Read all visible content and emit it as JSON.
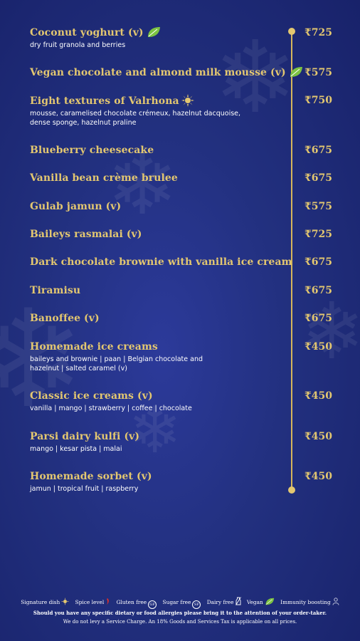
{
  "colors": {
    "background": "#22307f",
    "gold": "#e3c770",
    "leaf": "#7cc242"
  },
  "items": [
    {
      "name": "Coconut yoghurt (v)",
      "desc": "dry fruit granola and berries",
      "price": "₹725",
      "icon": "leaf-icon"
    },
    {
      "name": "Vegan chocolate and almond milk mousse (v)",
      "desc": "",
      "price": "₹575",
      "icon": "leaf-icon"
    },
    {
      "name": "Eight textures of Valrhona",
      "desc": "mousse, caramelised chocolate crémeux, hazelnut dacquoise,",
      "desc2": "dense sponge, hazelnut praline",
      "price": "₹750",
      "icon": "signature-icon"
    },
    {
      "name": "Blueberry cheesecake",
      "desc": "",
      "price": "₹675"
    },
    {
      "name": "Vanilla bean crème brulee",
      "desc": "",
      "price": "₹675"
    },
    {
      "name": "Gulab jamun (v)",
      "desc": "",
      "price": "₹575"
    },
    {
      "name": "Baileys rasmalai (v)",
      "desc": "",
      "price": "₹725"
    },
    {
      "name": "Dark chocolate brownie with vanilla ice cream",
      "desc": "",
      "price": "₹675"
    },
    {
      "name": "Tiramisu",
      "desc": "",
      "price": "₹675"
    },
    {
      "name": "Banoffee (v)",
      "desc": "",
      "price": "₹675"
    },
    {
      "name": "Homemade ice creams",
      "desc": "baileys and brownie | paan | Belgian chocolate and",
      "desc2": "hazelnut | salted caramel (v)",
      "price": "₹450"
    },
    {
      "name": "Classic ice creams (v)",
      "desc": "vanilla | mango | strawberry | coffee | chocolate",
      "price": "₹450"
    },
    {
      "name": "Parsi dairy kulfi (v)",
      "desc": "mango | kesar pista | malai",
      "price": "₹450"
    },
    {
      "name": "Homemade sorbet (v)",
      "desc": "jamun | tropical fruit | raspberry",
      "price": "₹450"
    }
  ],
  "legend": {
    "signature": "Signature dish",
    "spice": "Spice level",
    "gluten": "Gluten free",
    "gluten_badge": "GF",
    "sugar": "Sugar free",
    "sugar_badge": "SF",
    "dairy": "Dairy free",
    "vegan": "Vegan",
    "immunity": "Immunity boosting"
  },
  "notes": {
    "allergy": "Should you have any specific dietary or food allergies please bring it to the attention of your order-taker.",
    "tax": "We do not levy a Service Charge. An 18% Goods and Services Tax is applicable on all prices."
  }
}
